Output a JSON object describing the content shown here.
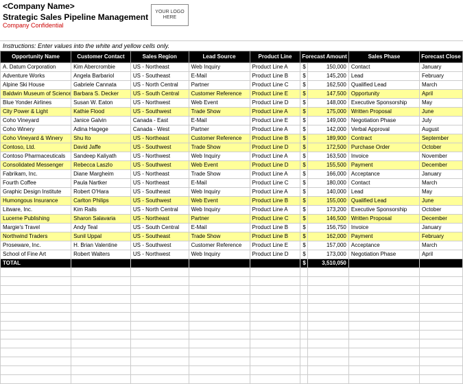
{
  "header": {
    "company": "<Company Name>",
    "title": "Strategic Sales Pipeline Management",
    "confidential": "Company Confidential",
    "logo": "YOUR LOGO HERE",
    "instructions": "Instructions: Enter values into the white and yellow cells only."
  },
  "columns": [
    "Opportunity Name",
    "Customer Contact",
    "Sales Region",
    "Lead Source",
    "Product Line",
    "Forecast Amount",
    "Sales Phase",
    "Forecast Close"
  ],
  "rows": [
    {
      "hl": false,
      "opp": "A. Datum Corporation",
      "contact": "Kim Abercrombie",
      "region": "US - Northeast",
      "lead": "Web Inquiry",
      "product": "Product Line A",
      "amount": "150,000",
      "phase": "Contact",
      "close": "January"
    },
    {
      "hl": false,
      "opp": "Adventure Works",
      "contact": "Angela Barbariol",
      "region": "US - Southeast",
      "lead": "E-Mail",
      "product": "Product Line B",
      "amount": "145,200",
      "phase": "Lead",
      "close": "February"
    },
    {
      "hl": false,
      "opp": "Alpine Ski House",
      "contact": "Gabriele Cannata",
      "region": "US - North Central",
      "lead": "Partner",
      "product": "Product Line C",
      "amount": "162,500",
      "phase": "Qualified Lead",
      "close": "March"
    },
    {
      "hl": true,
      "opp": "Baldwin Museum of Science",
      "contact": "Barbara S. Decker",
      "region": "US - South Central",
      "lead": "Customer Reference",
      "product": "Product Line E",
      "amount": "147,500",
      "phase": "Opportunity",
      "close": "April"
    },
    {
      "hl": false,
      "opp": "Blue Yonder Airlines",
      "contact": "Susan W. Eaton",
      "region": "US - Northwest",
      "lead": "Web Event",
      "product": "Product Line D",
      "amount": "148,000",
      "phase": "Executive Sponsorship",
      "close": "May"
    },
    {
      "hl": true,
      "opp": "City Power & Light",
      "contact": "Kathie Flood",
      "region": "US - Southwest",
      "lead": "Trade Show",
      "product": "Product Line A",
      "amount": "175,000",
      "phase": "Written Proposal",
      "close": "June"
    },
    {
      "hl": false,
      "opp": "Coho Vineyard",
      "contact": "Janice Galvin",
      "region": "Canada - East",
      "lead": "E-Mail",
      "product": "Product Line E",
      "amount": "149,000",
      "phase": "Negotiation Phase",
      "close": "July"
    },
    {
      "hl": false,
      "opp": "Coho Winery",
      "contact": "Adina Hagege",
      "region": "Canada - West",
      "lead": "Partner",
      "product": "Product Line A",
      "amount": "142,000",
      "phase": "Verbal Approval",
      "close": "August"
    },
    {
      "hl": true,
      "opp": "Coho Vineyard & Winery",
      "contact": "Shu Ito",
      "region": "US - Northeast",
      "lead": "Customer Reference",
      "product": "Product Line B",
      "amount": "189,900",
      "phase": "Contract",
      "close": "September"
    },
    {
      "hl": true,
      "opp": "Contoso, Ltd.",
      "contact": "David Jaffe",
      "region": "US - Southwest",
      "lead": "Trade Show",
      "product": "Product Line D",
      "amount": "172,500",
      "phase": "Purchase Order",
      "close": "October"
    },
    {
      "hl": false,
      "opp": "Contoso Pharmaceuticals",
      "contact": "Sandeep Kaliyath",
      "region": "US - Northwest",
      "lead": "Web Inquiry",
      "product": "Product Line A",
      "amount": "163,500",
      "phase": "Invoice",
      "close": "November"
    },
    {
      "hl": true,
      "opp": "Consolidated Messenger",
      "contact": "Rebecca Laszlo",
      "region": "US - Southwest",
      "lead": "Web Event",
      "product": "Product Line D",
      "amount": "155,500",
      "phase": "Payment",
      "close": "December"
    },
    {
      "hl": false,
      "opp": "Fabrikam, Inc.",
      "contact": "Diane Margheim",
      "region": "US - Northeast",
      "lead": "Trade Show",
      "product": "Product Line A",
      "amount": "166,000",
      "phase": "Acceptance",
      "close": "January"
    },
    {
      "hl": false,
      "opp": "Fourth Coffee",
      "contact": "Paula Nartker",
      "region": "US - Northeast",
      "lead": "E-Mail",
      "product": "Product Line C",
      "amount": "180,000",
      "phase": "Contact",
      "close": "March"
    },
    {
      "hl": false,
      "opp": "Graphic Design Institute",
      "contact": "Robert O'Hara",
      "region": "US - Southeast",
      "lead": "Web Inquiry",
      "product": "Product Line A",
      "amount": "140,000",
      "phase": "Lead",
      "close": "May"
    },
    {
      "hl": true,
      "opp": "Humongous Insurance",
      "contact": "Carlton Philips",
      "region": "US - Southwest",
      "lead": "Web Event",
      "product": "Product Line B",
      "amount": "155,000",
      "phase": "Qualified Lead",
      "close": "June"
    },
    {
      "hl": false,
      "opp": "Litware, Inc.",
      "contact": "Kim Ralls",
      "region": "US - North Central",
      "lead": "Web Inquiry",
      "product": "Product Line A",
      "amount": "173,200",
      "phase": "Executive Sponsorship",
      "close": "October"
    },
    {
      "hl": true,
      "opp": "Lucerne Publishing",
      "contact": "Sharon Salavaria",
      "region": "US - Northeast",
      "lead": "Partner",
      "product": "Product Line C",
      "amount": "146,500",
      "phase": "Written Proposal",
      "close": "December"
    },
    {
      "hl": false,
      "opp": "Margie's Travel",
      "contact": "Andy Teal",
      "region": "US - South Central",
      "lead": "E-Mail",
      "product": "Product Line B",
      "amount": "156,750",
      "phase": "Invoice",
      "close": "January"
    },
    {
      "hl": true,
      "opp": "Northwind Traders",
      "contact": "Sunil Uppal",
      "region": "US - Southeast",
      "lead": "Trade Show",
      "product": "Product Line B",
      "amount": "162,000",
      "phase": "Payment",
      "close": "February"
    },
    {
      "hl": false,
      "opp": "Proseware, Inc.",
      "contact": "H. Brian Valentine",
      "region": "US - Southwest",
      "lead": "Customer Reference",
      "product": "Product Line E",
      "amount": "157,000",
      "phase": "Acceptance",
      "close": "March"
    },
    {
      "hl": false,
      "opp": "School of Fine Art",
      "contact": "Robert Walters",
      "region": "US - Northwest",
      "lead": "Web Inquiry",
      "product": "Product Line D",
      "amount": "173,000",
      "phase": "Negotiation Phase",
      "close": "April"
    }
  ],
  "total": {
    "label": "TOTAL",
    "amount": "3,510,050"
  },
  "currency": "$",
  "empty_rows": 13
}
